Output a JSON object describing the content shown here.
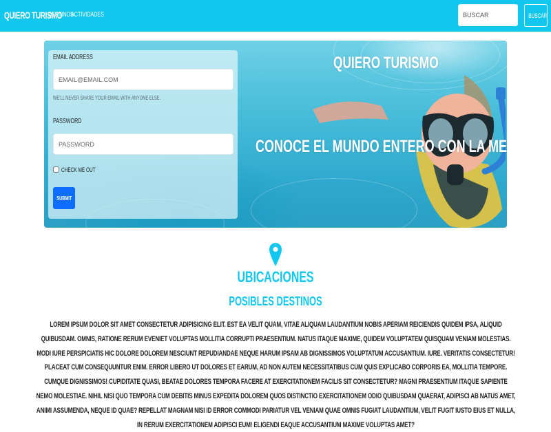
{
  "navbar": {
    "brand": "Quiero Turismo",
    "links": [
      {
        "label": "Destinos"
      },
      {
        "label": "Actividades"
      }
    ],
    "search": {
      "placeholder": "Buscar",
      "button_label": "Buscar"
    }
  },
  "hero": {
    "title": "Quiero Turismo",
    "tagline": "Conoce el mundo entero con la mejor compañia"
  },
  "form": {
    "email_label": "Email address",
    "email_placeholder": "email@email.com",
    "email_help": "We'll never share your email with anyone else.",
    "password_label": "Password",
    "password_placeholder": "Password",
    "check_label": "Check me out",
    "check_checked": false,
    "submit_label": "Submit"
  },
  "locations": {
    "icon": "map-pin-icon",
    "title": "Ubicaciones",
    "subtitle": "Posibles destinos",
    "body": "Lorem ipsum dolor sit amet consectetur adipisicing elit. Est ea velit quam, vitae aliquam laudantium nobis aperiam reiciendis quidem ipsa, aliquid quibusdam. Omnis, ratione rerum eveniet voluptas mollitia corrupti praesentium. Natus itaque maxime, quidem voluptatem quisquam veniam molestias. Modi iure perspiciatis hic dolore dolorem nesciunt repudiandae neque harum ipsam ab dignissimos voluptatum accusantium. Iure. Veritatis consectetur! Placeat cum consequuntur enim. Error libero ut dolores et earum, ad non autem necessitatibus cum quis explicabo corporis ea, mollitia tempore. Cumque dignissimos! Cupiditate quasi, beatae dolores tempora facere at exercitationem facilis sit consectetur? Magni praesentium itaque sapiente nemo molestiae. Nihil nisi quo tempora cum debitis minus expedita dolorem quos distinctio exercitationem odio quibusdam quaerat, adipisci ab natus amet, animi assumenda, neque id quae? Repellat magnam nisi id error commodi pariatur vel veniam quae omnis fugiat laudantium, velit fugit iusto eius et nulla, in rerum exercitationem adipisci eum! Eligendi eaque accusantium maxime voluptas amet?"
  },
  "colors": {
    "navbar": "#12c7ee",
    "accent": "#12c7ee",
    "submit": "#0d6efd"
  }
}
